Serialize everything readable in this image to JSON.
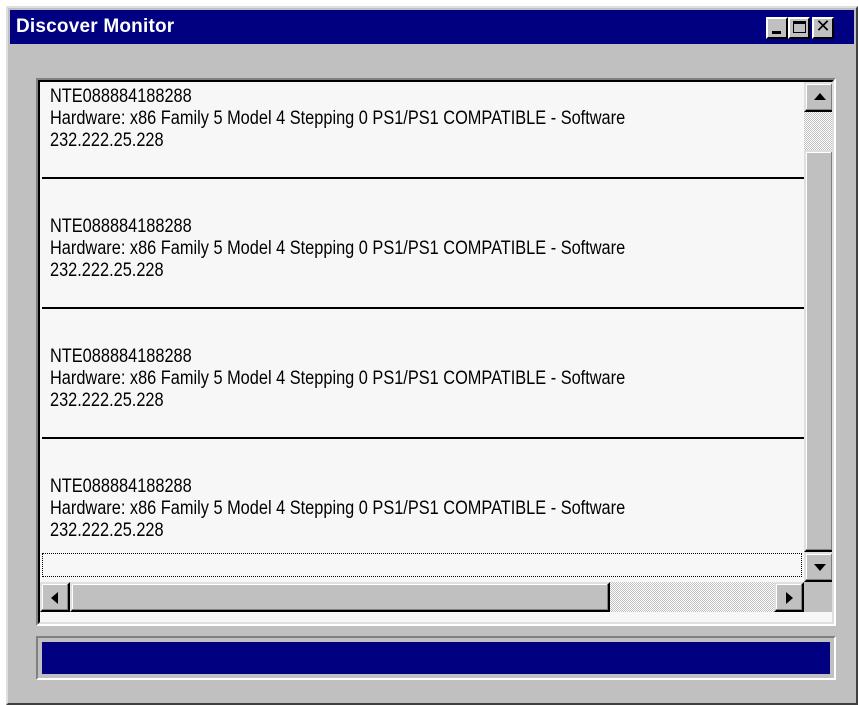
{
  "window": {
    "title": "Discover Monitor",
    "controls": {
      "minimize": "minimize",
      "maximize": "maximize",
      "close": "close"
    }
  },
  "list": {
    "entries": [
      {
        "name": "NTE088884188288",
        "description": "Hardware: x86 Family 5 Model 4 Stepping 0 PS1/PS1 COMPATIBLE  - Software",
        "address": "232.222.25.228"
      },
      {
        "name": "NTE088884188288",
        "description": "Hardware: x86 Family 5 Model 4 Stepping 0 PS1/PS1 COMPATIBLE  - Software",
        "address": "232.222.25.228"
      },
      {
        "name": "NTE088884188288",
        "description": "Hardware: x86 Family 5 Model 4 Stepping 0 PS1/PS1 COMPATIBLE  - Software",
        "address": "232.222.25.228"
      },
      {
        "name": "NTE088884188288",
        "description": "Hardware: x86 Family 5 Model 4 Stepping 0 PS1/PS1 COMPATIBLE  - Software",
        "address": "232.222.25.228"
      }
    ]
  },
  "icons": {
    "minimize": "minimize-icon",
    "maximize": "maximize-icon",
    "close": "close-icon",
    "scroll_up": "arrow-up-icon",
    "scroll_down": "arrow-down-icon",
    "scroll_left": "arrow-left-icon",
    "scroll_right": "arrow-right-icon"
  },
  "colors": {
    "titlebar": "#000080",
    "window_face": "#c0c0c0",
    "list_background": "#f7f7f7",
    "status_bar": "#000080"
  }
}
